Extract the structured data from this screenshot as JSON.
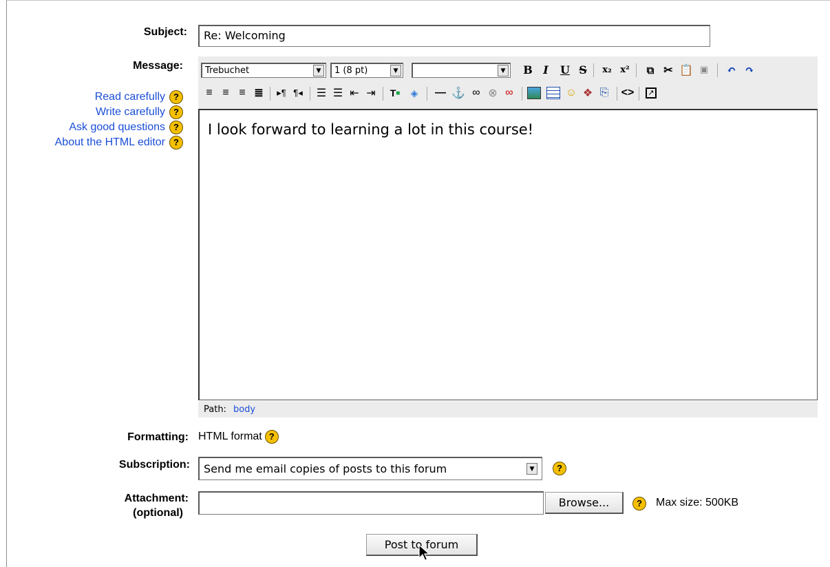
{
  "form": {
    "subject_label": "Subject:",
    "subject_value": "Re: Welcoming",
    "message_label": "Message:",
    "help_links": [
      {
        "label": "Read carefully"
      },
      {
        "label": "Write carefully"
      },
      {
        "label": "Ask good questions"
      },
      {
        "label": "About the HTML editor"
      }
    ],
    "help_glyph": "?",
    "editor": {
      "font_family": "Trebuchet",
      "font_size": "1 (8 pt)",
      "paragraph_style": "",
      "body_text": "I look forward to learning a lot in this course!",
      "path_label": "Path:",
      "path_value": "body"
    },
    "formatting_label": "Formatting:",
    "formatting_value": "HTML format",
    "subscription_label": "Subscription:",
    "subscription_value": "Send me email copies of posts to this forum",
    "attachment_label": "Attachment:",
    "attachment_sublabel": "(optional)",
    "attachment_value": "",
    "browse_label": "Browse...",
    "max_size": "Max size: 500KB",
    "submit_label": "Post to forum"
  },
  "toolbar_row1": [
    "bold",
    "italic",
    "underline",
    "strikethrough",
    "subscript",
    "superscript",
    "copy",
    "cut",
    "paste",
    "paste-word",
    "undo",
    "redo"
  ],
  "toolbar_row2": [
    "align-left",
    "align-center",
    "align-right",
    "justify",
    "ltr",
    "rtl",
    "ordered-list",
    "unordered-list",
    "outdent",
    "indent",
    "text-color",
    "bg-color",
    "horizontal-rule",
    "anchor",
    "link",
    "unlink",
    "nolink",
    "image",
    "table",
    "smiley",
    "special-char",
    "search-replace",
    "html-source",
    "fullscreen"
  ],
  "colors": {
    "link": "#1a4ed8",
    "help": "#f5c000",
    "toolbar_bg": "#ececec"
  }
}
